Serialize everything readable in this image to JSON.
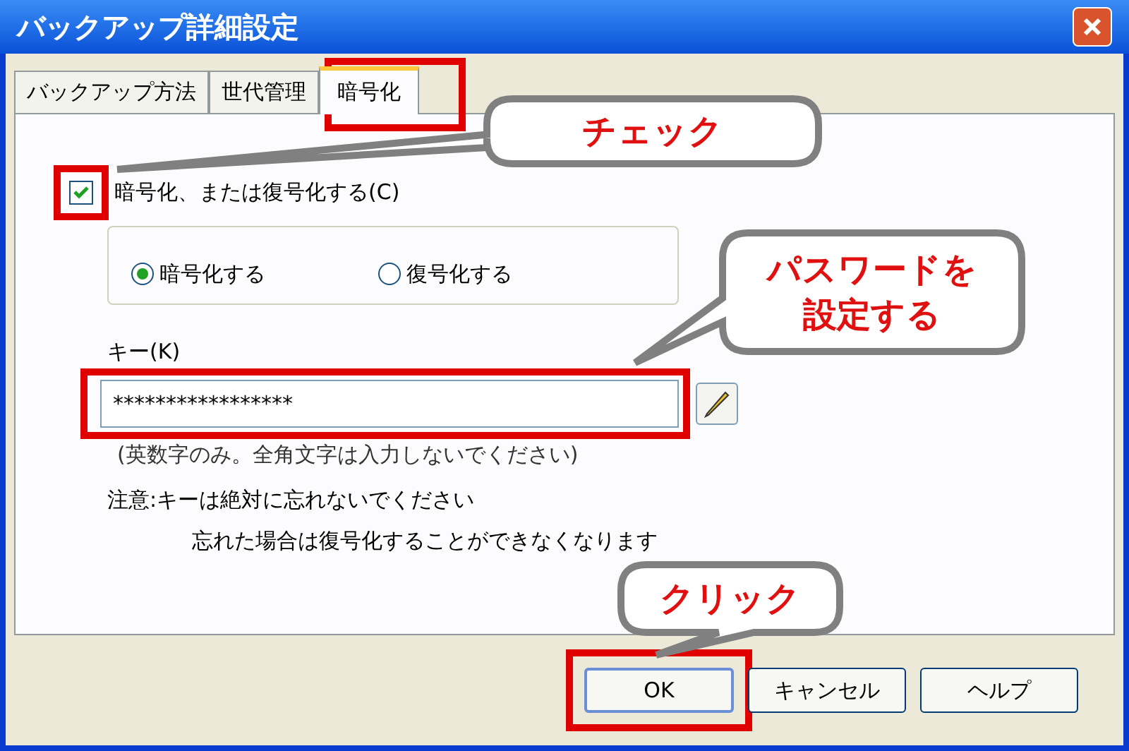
{
  "window": {
    "title": "バックアップ詳細設定"
  },
  "tabs": [
    {
      "label": "バックアップ方法",
      "selected": false
    },
    {
      "label": "世代管理",
      "selected": false
    },
    {
      "label": "暗号化",
      "selected": true
    }
  ],
  "encrypt_checkbox": {
    "label": "暗号化、または復号化する(C)",
    "checked": true
  },
  "mode_radios": [
    {
      "label": "暗号化する",
      "selected": true
    },
    {
      "label": "復号化する",
      "selected": false
    }
  ],
  "key": {
    "label": "キー(K)",
    "value": "*****************"
  },
  "hint": "(英数字のみ。全角文字は入力しないでください)",
  "notes": [
    "注意:キーは絶対に忘れないでください",
    "忘れた場合は復号化することができなくなります"
  ],
  "buttons": [
    {
      "label": "OK",
      "highlighted": true
    },
    {
      "label": "キャンセル",
      "highlighted": false
    },
    {
      "label": "ヘルプ",
      "highlighted": false
    }
  ],
  "callouts": [
    {
      "lines": [
        "チェック"
      ]
    },
    {
      "lines": [
        "パスワードを",
        "設定する"
      ]
    },
    {
      "lines": [
        "クリック"
      ]
    }
  ]
}
